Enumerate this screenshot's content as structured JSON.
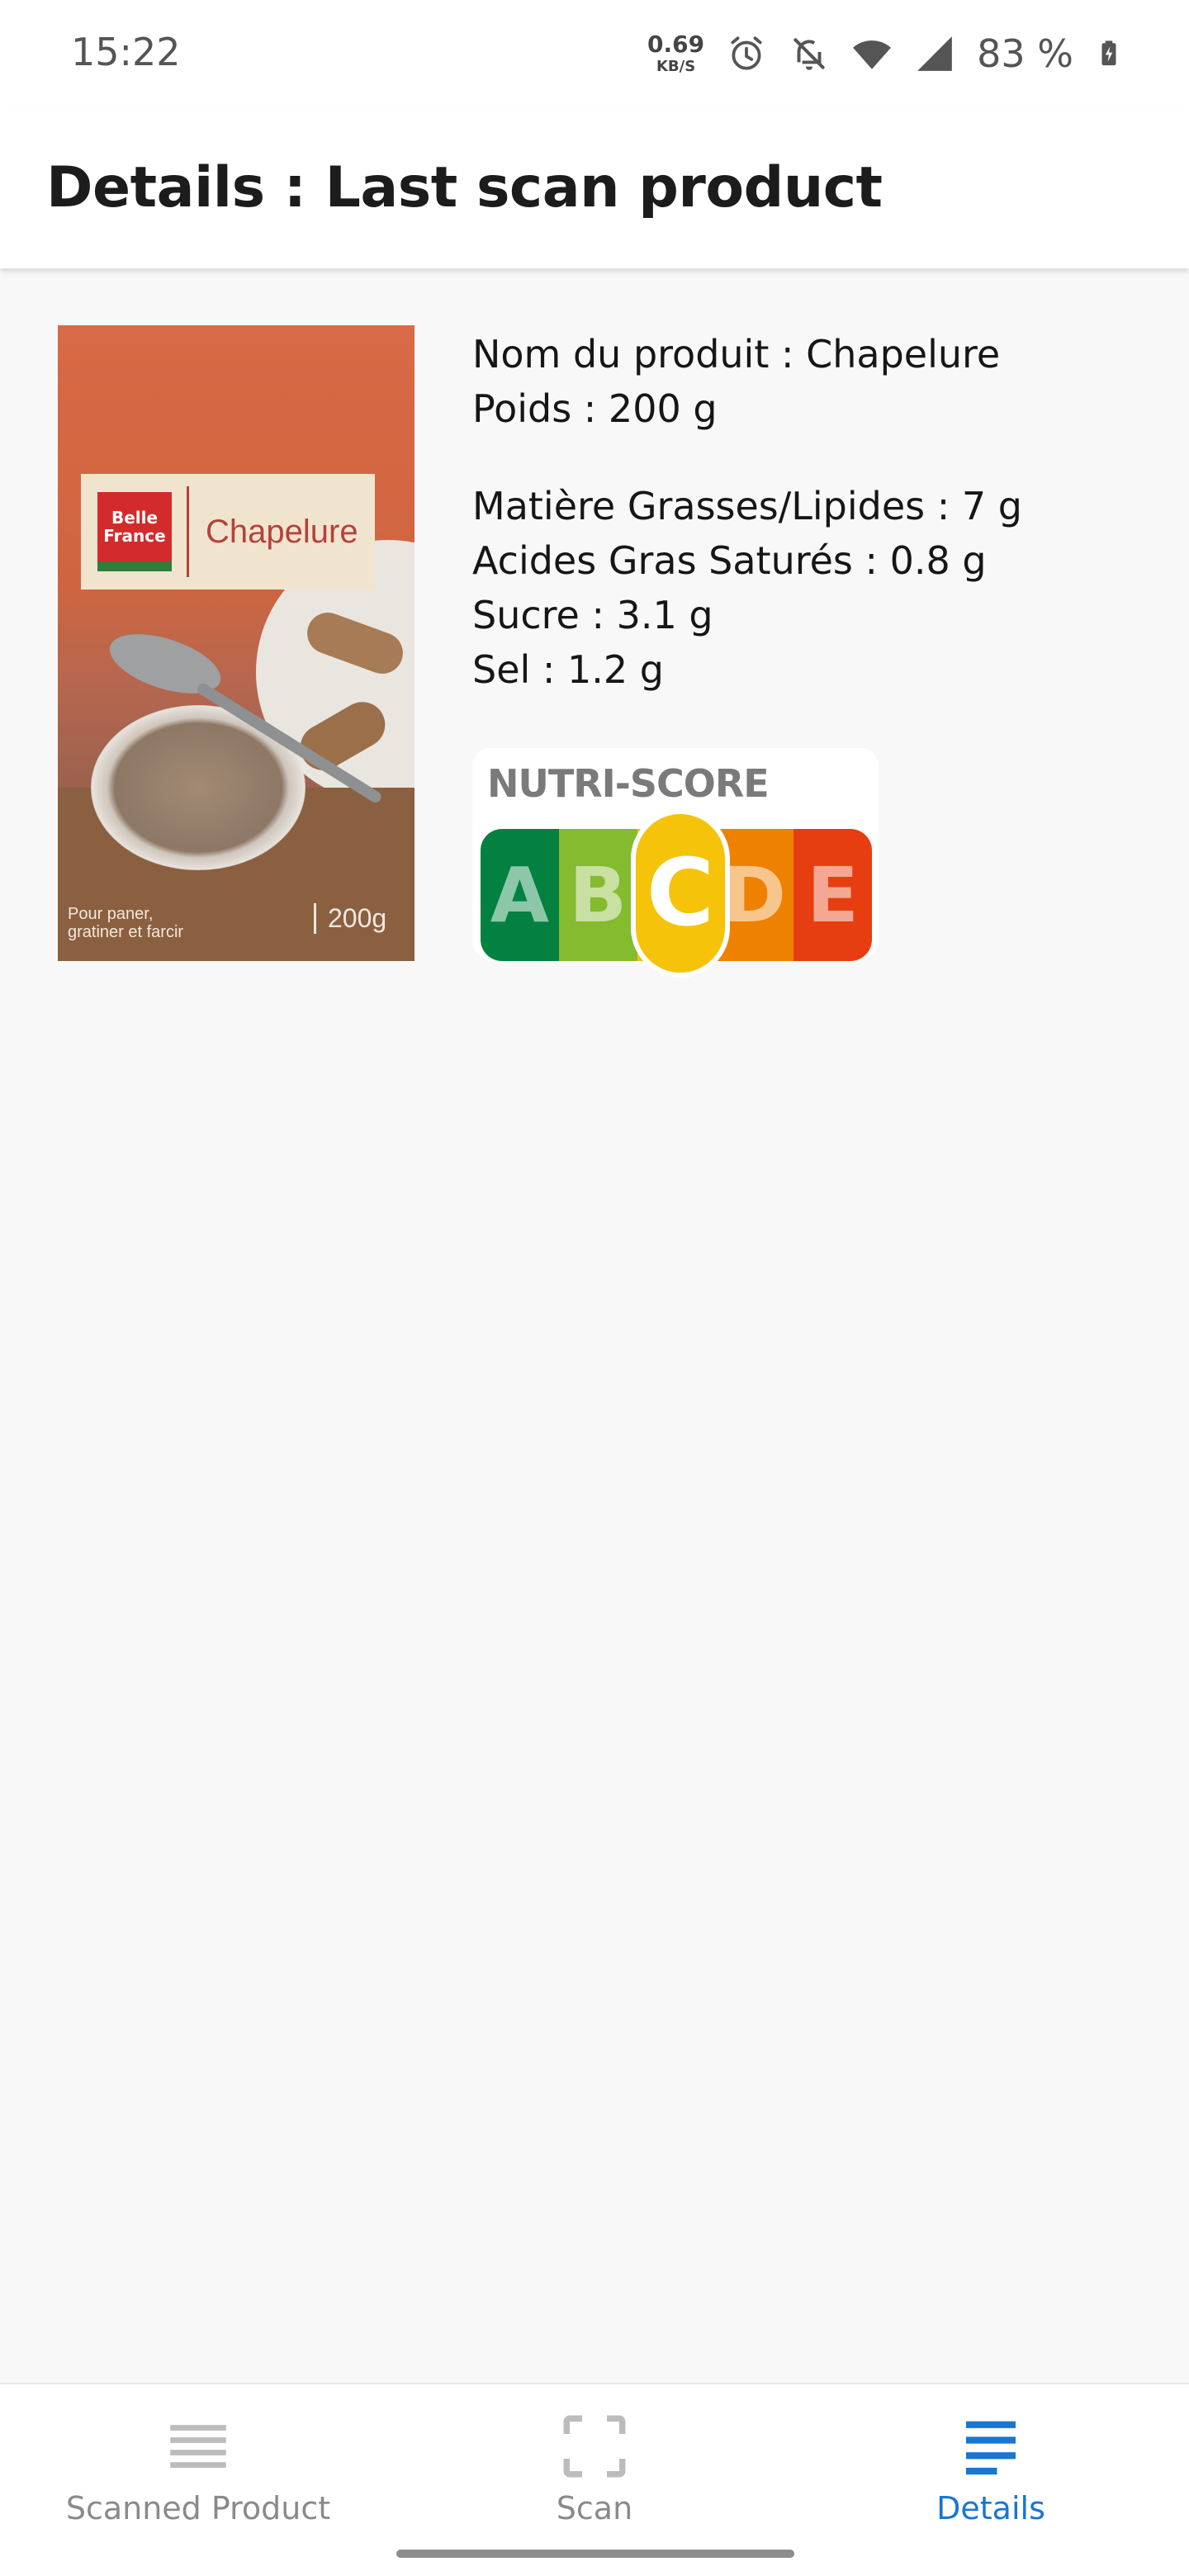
{
  "status_bar": {
    "time": "15:22",
    "net_speed_value": "0.69",
    "net_speed_unit": "KB/S",
    "battery": "83 %",
    "icons": [
      "alarm-icon",
      "bell-off-icon",
      "wifi-icon",
      "cell-signal-icon",
      "battery-charging-icon"
    ]
  },
  "app_bar": {
    "title": "Details : Last scan product"
  },
  "product": {
    "image": {
      "brand_line1": "Belle",
      "brand_line2": "France",
      "name": "Chapelure",
      "foot_left_line1": "Pour paner,",
      "foot_left_line2": "gratiner et farcir",
      "foot_right": "200g"
    },
    "name_line": "Nom du produit : Chapelure",
    "weight_line": "Poids : 200 g",
    "fat_line": "Matière Grasses/Lipides : 7 g",
    "saturated_line": "Acides Gras Saturés : 0.8 g",
    "sugar_line": "Sucre : 3.1 g",
    "salt_line": "Sel : 1.2 g"
  },
  "nutri_score": {
    "title": "NUTRI-SCORE",
    "grades": [
      "A",
      "B",
      "C",
      "D",
      "E"
    ],
    "active": "C",
    "colors": {
      "A": "#038141",
      "B": "#85bb2f",
      "C": "#f6c30b",
      "D": "#ee8100",
      "E": "#e63e11"
    }
  },
  "bottom_nav": {
    "items": [
      {
        "label": "Scanned Product",
        "icon": "list-icon",
        "active": false
      },
      {
        "label": "Scan",
        "icon": "scan-frame-icon",
        "active": false
      },
      {
        "label": "Details",
        "icon": "details-list-icon",
        "active": true
      }
    ],
    "accent": "#1976d2",
    "inactive": "#8a8a8a"
  }
}
